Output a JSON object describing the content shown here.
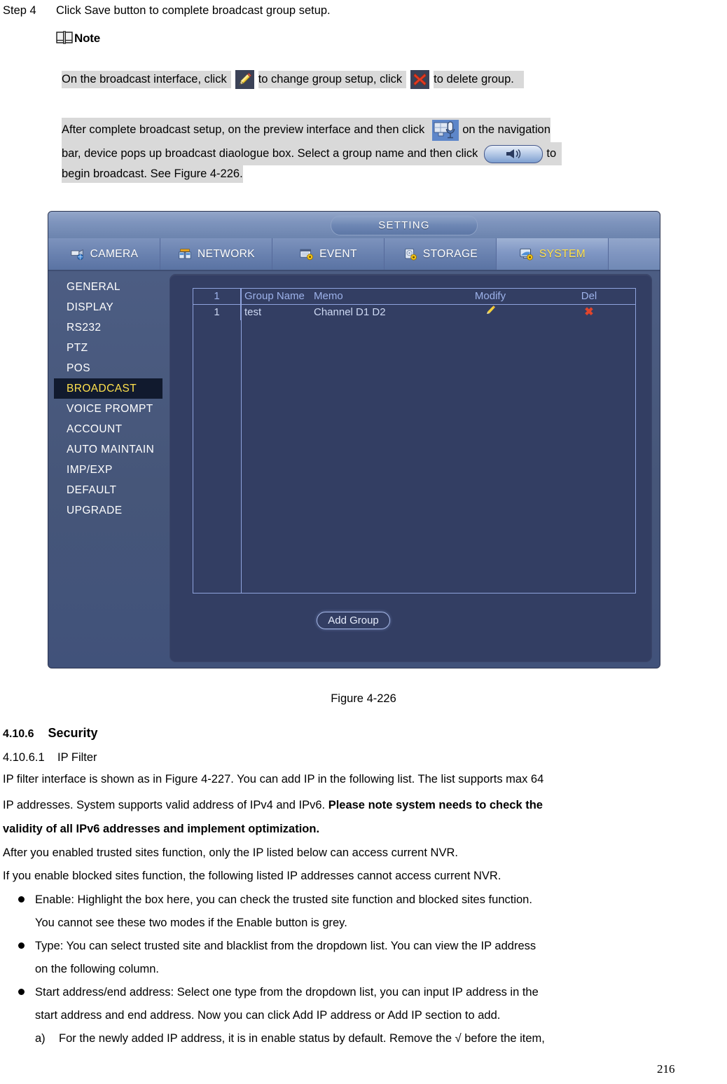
{
  "document": {
    "step": {
      "label": "Step 4",
      "text": "Click Save button to complete broadcast group setup."
    },
    "note": {
      "heading": "Note",
      "icon": "book-icon",
      "paragraph1": {
        "part1": "On the broadcast interface, click",
        "icon1": "pencil-icon",
        "part2": "to change group setup, click",
        "icon2": "red-x-icon",
        "part3": "to delete group."
      },
      "paragraph2": {
        "part1": "After complete broadcast setup, on the preview interface and then click",
        "icon1": "navigation-broadcast-icon",
        "part2": "on the navigation",
        "part3": "bar, device pops up broadcast diaologue box. Select a group name and then click",
        "icon2": "speaker-horn-button-icon",
        "part4": "to",
        "part5": "begin broadcast. See Figure 4-226."
      }
    },
    "figure_caption": "Figure 4-226",
    "section": {
      "number": "4.10.6",
      "title": "Security"
    },
    "subsection": {
      "number": "4.10.6.1",
      "title": "IP Filter"
    },
    "paragraphs": [
      {
        "plain1": "IP filter interface is shown as in Figure 4-227. You can add IP in the following list. The list supports max 64"
      },
      {
        "plain1": "IP addresses. System supports valid address of IPv4 and IPv6. ",
        "bold1": "Please note system needs to check the"
      },
      {
        "bold1": "validity of all IPv6 addresses and implement optimization."
      },
      {
        "plain1": "After you enabled trusted sites function, only the IP listed below can access current NVR."
      },
      {
        "plain1": "If you enable blocked sites function, the following listed IP addresses cannot access current NVR."
      }
    ],
    "bullets": [
      {
        "line1": "Enable: Highlight the box here, you can check the trusted site function and blocked sites function.",
        "line2": "You cannot see these two modes if the Enable button is grey."
      },
      {
        "line1": "Type: You can select trusted site and blacklist from the dropdown list. You can view the IP address",
        "line2": "on the following column."
      },
      {
        "line1": "Start address/end address: Select one type from the dropdown list, you can input IP address in the",
        "line2": "start address and end address. Now you can click Add IP address or Add IP section to add."
      }
    ],
    "sub_item": {
      "marker": "a)",
      "text": "For the newly added IP address, it is in enable status by default. Remove the √ before the item,"
    },
    "page_number": "216"
  },
  "nvr": {
    "title": "SETTING",
    "tabs": [
      {
        "label": "CAMERA",
        "icon": "camera-icon",
        "active": false
      },
      {
        "label": "NETWORK",
        "icon": "network-icon",
        "active": false
      },
      {
        "label": "EVENT",
        "icon": "event-icon",
        "active": false
      },
      {
        "label": "STORAGE",
        "icon": "storage-icon",
        "active": false
      },
      {
        "label": "SYSTEM",
        "icon": "system-icon",
        "active": true
      }
    ],
    "sidebar": [
      {
        "label": "GENERAL",
        "active": false
      },
      {
        "label": "DISPLAY",
        "active": false
      },
      {
        "label": "RS232",
        "active": false
      },
      {
        "label": "PTZ",
        "active": false
      },
      {
        "label": "POS",
        "active": false
      },
      {
        "label": "BROADCAST",
        "active": true
      },
      {
        "label": "VOICE PROMPT",
        "active": false
      },
      {
        "label": "ACCOUNT",
        "active": false
      },
      {
        "label": "AUTO MAINTAIN",
        "active": false
      },
      {
        "label": "IMP/EXP",
        "active": false
      },
      {
        "label": "DEFAULT",
        "active": false
      },
      {
        "label": "UPGRADE",
        "active": false
      }
    ],
    "table": {
      "headers": {
        "index": "1",
        "name": "Group Name",
        "memo": "Memo",
        "modify": "Modify",
        "del": "Del"
      },
      "rows": [
        {
          "index": "1",
          "name": "test",
          "memo": "Channel  D1  D2",
          "modify_icon": "pencil-icon",
          "del_icon": "red-x-icon"
        }
      ]
    },
    "add_group_label": "Add Group",
    "colors": {
      "panel_bg": "#333e63",
      "window_bg": "#4a5b81",
      "titlebar": "#7e94bd",
      "active_tab_text": "#ffe14d",
      "active_menu_bg": "#111a2e",
      "table_border": "#8fa3dd",
      "table_text": "#9db2ea",
      "delete_red": "#e0452c",
      "pencil_yellow": "#f5d13b"
    }
  }
}
